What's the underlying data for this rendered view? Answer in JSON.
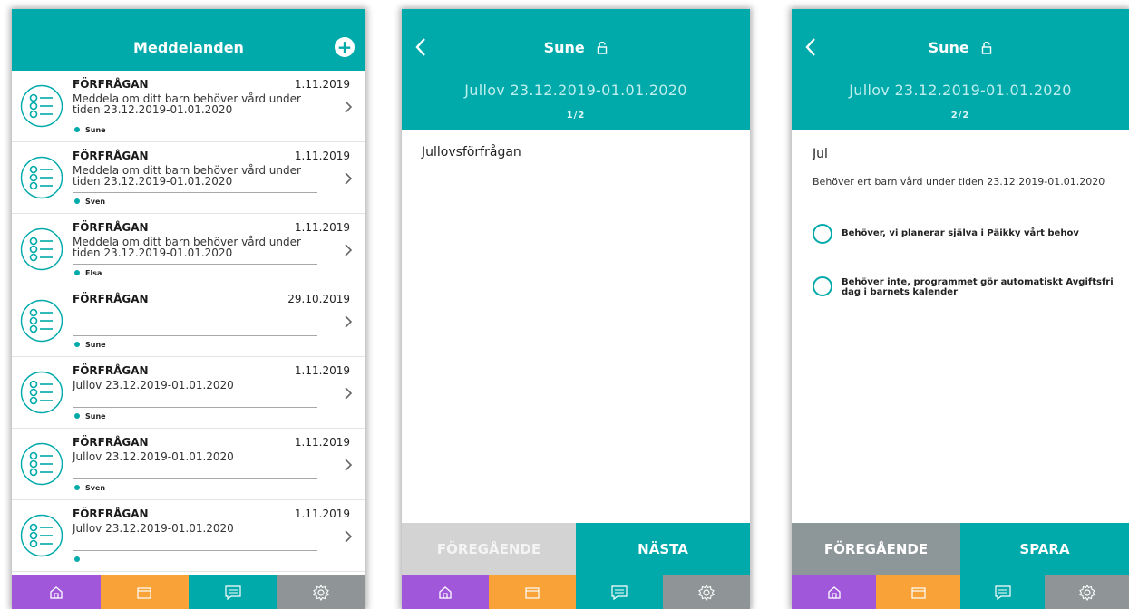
{
  "colors": {
    "accent": "#00a9aa",
    "nav_home": "#a157d9",
    "nav_calendar": "#f9a237",
    "nav_messages": "#00a9aa",
    "nav_settings": "#8f9596"
  },
  "screen1": {
    "title": "Meddelanden",
    "add_icon": "plus-circle-icon",
    "messages": [
      {
        "type": "FÖRFRÅGAN",
        "date": "1.11.2019",
        "text": "Meddela om ditt barn behöver vård under tiden 23.12.2019-01.01.2020",
        "child": "Sune"
      },
      {
        "type": "FÖRFRÅGAN",
        "date": "1.11.2019",
        "text": "Meddela om ditt barn behöver vård under tiden 23.12.2019-01.01.2020",
        "child": "Sven"
      },
      {
        "type": "FÖRFRÅGAN",
        "date": "1.11.2019",
        "text": "Meddela om ditt barn behöver vård under tiden 23.12.2019-01.01.2020",
        "child": "Elsa"
      },
      {
        "type": "FÖRFRÅGAN",
        "date": "29.10.2019",
        "text": "",
        "child": "Sune"
      },
      {
        "type": "FÖRFRÅGAN",
        "date": "1.11.2019",
        "text": "Jullov 23.12.2019-01.01.2020",
        "child": "Sune"
      },
      {
        "type": "FÖRFRÅGAN",
        "date": "1.11.2019",
        "text": "Jullov 23.12.2019-01.01.2020",
        "child": "Sven"
      },
      {
        "type": "FÖRFRÅGAN",
        "date": "1.11.2019",
        "text": "Jullov 23.12.2019-01.01.2020",
        "child": ""
      }
    ],
    "nav": [
      "home-icon",
      "calendar-icon",
      "messages-icon",
      "settings-icon"
    ]
  },
  "screen2": {
    "title": "Sune",
    "subtitle": "Jullov 23.12.2019-01.01.2020",
    "pager": "1/2",
    "content_title": "Jullovsförfrågan",
    "prev_label": "FÖREGÅENDE",
    "next_label": "NÄSTA",
    "prev_enabled": false
  },
  "screen3": {
    "title": "Sune",
    "subtitle": "Jullov 23.12.2019-01.01.2020",
    "pager": "2/2",
    "heading": "Jul",
    "question": "Behöver ert barn vård under tiden 23.12.2019-01.01.2020",
    "options": [
      "Behöver, vi planerar själva i Päikky vårt behov",
      "Behöver inte, programmet gör automatiskt Avgiftsfri dag i barnets kalender"
    ],
    "prev_label": "FÖREGÅENDE",
    "save_label": "SPARA"
  }
}
